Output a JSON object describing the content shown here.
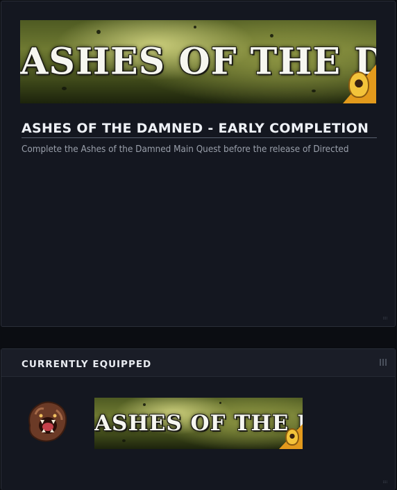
{
  "details": {
    "banner_text": "ASHES OF THE DAMNED",
    "title": "ASHES OF THE DAMNED - EARLY COMPLETION",
    "description": "Complete the Ashes of the Damned Main Quest before the release of Directed"
  },
  "equipped": {
    "header": "CURRENTLY EQUIPPED",
    "emblem_icon": "roaring-beast-emblem-icon",
    "banner_text": "ASHES OF THE DAMNED"
  },
  "colors": {
    "panel_bg": "#141720",
    "header_bg": "#1a1d27",
    "title_text": "#eef1f6",
    "description_text": "#9aa0ab",
    "badge_orange": "#e39a1c"
  }
}
